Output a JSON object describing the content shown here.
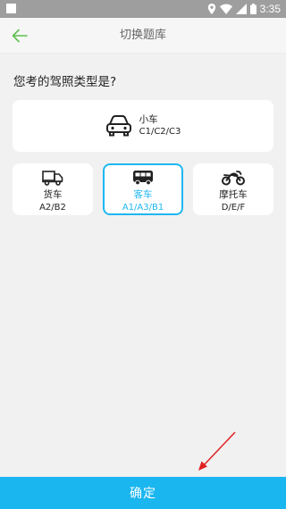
{
  "status_bar": {
    "time": "3:35",
    "icons": [
      "location-icon",
      "wifi-icon",
      "signal-icon",
      "battery-icon"
    ]
  },
  "header": {
    "title": "切换题库",
    "back_icon": "arrow-left-icon"
  },
  "question": "您考的驾照类型是?",
  "license_types": [
    {
      "name": "小车",
      "codes": "C1/C2/C3",
      "icon": "car-icon",
      "selected": false
    },
    {
      "name": "货车",
      "codes": "A2/B2",
      "icon": "truck-icon",
      "selected": false
    },
    {
      "name": "客车",
      "codes": "A1/A3/B1",
      "icon": "bus-icon",
      "selected": true
    },
    {
      "name": "摩托车",
      "codes": "D/E/F",
      "icon": "motorcycle-icon",
      "selected": false
    }
  ],
  "confirm_label": "确定",
  "colors": {
    "accent": "#1ab6ef",
    "selected_border": "#1eb7f0",
    "back_arrow": "#5fbf4f",
    "annotation_arrow": "#e02020"
  }
}
